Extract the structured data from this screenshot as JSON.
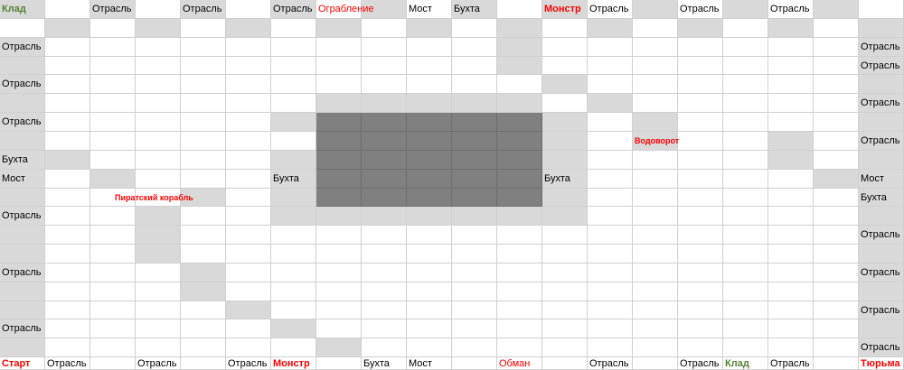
{
  "sheet": {
    "colors": {
      "grid_line": "#d0d0d0",
      "light_gray": "#d9d9d9",
      "dark_gray": "#808080",
      "red_text": "#ff0000",
      "green_text": "#538135"
    },
    "labels": [
      {
        "id": "l0",
        "text": "Клад",
        "style": "green"
      },
      {
        "id": "l1",
        "text": "Отрасль",
        "style": "normal"
      },
      {
        "id": "l2",
        "text": "Отрасль",
        "style": "normal"
      },
      {
        "id": "l3",
        "text": "Отрасль",
        "style": "normal"
      },
      {
        "id": "l4",
        "text": "Ограбление",
        "style": "red-plain"
      },
      {
        "id": "l5",
        "text": "Мост",
        "style": "normal"
      },
      {
        "id": "l6",
        "text": "Бухта",
        "style": "normal"
      },
      {
        "id": "l7",
        "text": "Монстр",
        "style": "red"
      },
      {
        "id": "l8",
        "text": "Отрасль",
        "style": "normal"
      },
      {
        "id": "l9",
        "text": "Отрасль",
        "style": "normal"
      },
      {
        "id": "l10",
        "text": "Отрасль",
        "style": "normal"
      },
      {
        "id": "l11",
        "text": "Отрасль",
        "style": "normal"
      },
      {
        "id": "l12",
        "text": "Отрасль",
        "style": "normal"
      },
      {
        "id": "l13",
        "text": "Отрасль",
        "style": "normal"
      },
      {
        "id": "l14",
        "text": "Отрасль",
        "style": "normal"
      },
      {
        "id": "l15",
        "text": "Отрасль",
        "style": "normal"
      },
      {
        "id": "l16",
        "text": "Отрасль",
        "style": "normal"
      },
      {
        "id": "l17",
        "text": "Водоворот",
        "style": "red-small"
      },
      {
        "id": "l18",
        "text": "Отрасль",
        "style": "normal"
      },
      {
        "id": "l19",
        "text": "Бухта",
        "style": "normal"
      },
      {
        "id": "l20",
        "text": "Мост",
        "style": "normal"
      },
      {
        "id": "l21",
        "text": "Бухта",
        "style": "normal"
      },
      {
        "id": "l22",
        "text": "Бухта",
        "style": "normal"
      },
      {
        "id": "l23",
        "text": "Мост",
        "style": "normal"
      },
      {
        "id": "l24",
        "text": "Пиратский корабль",
        "style": "red-small"
      },
      {
        "id": "l25",
        "text": "Бухта",
        "style": "normal"
      },
      {
        "id": "l26",
        "text": "Отрасль",
        "style": "normal"
      },
      {
        "id": "l27",
        "text": "Отрасль",
        "style": "normal"
      },
      {
        "id": "l28",
        "text": "Отрасль",
        "style": "normal"
      },
      {
        "id": "l29",
        "text": "Отрасль",
        "style": "normal"
      },
      {
        "id": "l30",
        "text": "Отрасль",
        "style": "normal"
      },
      {
        "id": "l31",
        "text": "Отрасль",
        "style": "normal"
      },
      {
        "id": "l32",
        "text": "Отрасль",
        "style": "normal"
      },
      {
        "id": "l33",
        "text": "Старт",
        "style": "red"
      },
      {
        "id": "l34",
        "text": "Отрасль",
        "style": "normal"
      },
      {
        "id": "l35",
        "text": "Отрасль",
        "style": "normal"
      },
      {
        "id": "l36",
        "text": "Отрасль",
        "style": "normal"
      },
      {
        "id": "l37",
        "text": "Монстр",
        "style": "red"
      },
      {
        "id": "l38",
        "text": "Бухта",
        "style": "normal"
      },
      {
        "id": "l39",
        "text": "Мост",
        "style": "normal"
      },
      {
        "id": "l40",
        "text": "Обман",
        "style": "red-plain"
      },
      {
        "id": "l41",
        "text": "Отрасль",
        "style": "normal"
      },
      {
        "id": "l42",
        "text": "Отрасль",
        "style": "normal"
      },
      {
        "id": "l43",
        "text": "Клад",
        "style": "green"
      },
      {
        "id": "l44",
        "text": "Отрасль",
        "style": "normal"
      },
      {
        "id": "l45",
        "text": "Тюрьма",
        "style": "red"
      }
    ]
  }
}
